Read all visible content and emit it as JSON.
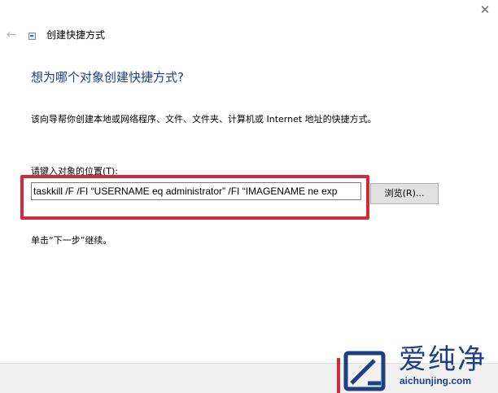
{
  "window": {
    "title": "创建快捷方式",
    "back_icon": "arrow-left-icon",
    "close_icon": "close-icon",
    "close_glyph": "✕",
    "back_glyph": "←"
  },
  "page": {
    "heading": "想为哪个对象创建快捷方式?",
    "description": "该向导帮你创建本地或网络程序、文件、文件夹、计算机或 Internet 地址的快捷方式。",
    "location_label": "请键入对象的位置(T):",
    "location_value": "taskkill /F /FI “USERNAME eq administrator” /FI “IMAGENAME ne exp",
    "browse_label": "浏览(R)...",
    "hint": "单击“下一步”继续。"
  },
  "watermark": {
    "name": "爱纯净",
    "url": "aichunjing.com"
  },
  "colors": {
    "heading": "#1e3f8b",
    "highlight": "#d22a3a",
    "watermark": "#1d3f84"
  }
}
